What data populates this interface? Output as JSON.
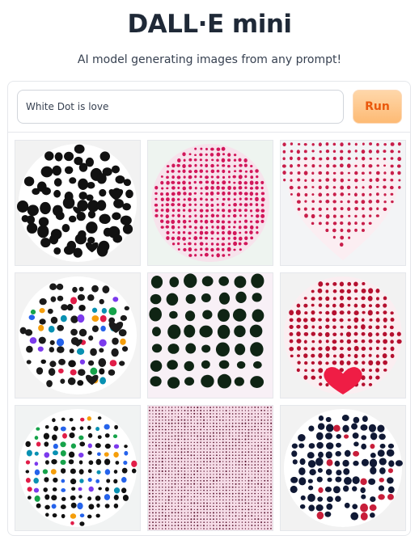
{
  "header": {
    "title": "DALL·E mini",
    "subtitle": "AI model generating images from any prompt!"
  },
  "prompt": {
    "value": "White Dot is love"
  },
  "run_button": {
    "label": "Run"
  },
  "colors": {
    "accent": "#fdba74",
    "accent_text": "#ea580c"
  },
  "gallery": {
    "images": [
      {
        "description_icon": "black-dots-circle",
        "bg": "#f2f2f2",
        "shape": "circle",
        "fill": "#ffffff",
        "dot": "#111111",
        "dotSize": 6,
        "spacing": 15,
        "jitter": 0.7,
        "hearts": true
      },
      {
        "description_icon": "pink-dots-circle",
        "bg": "#eef4f0",
        "shape": "circle",
        "fill": "#f7e3ec",
        "dot": "#d2165a",
        "dotSize": 2,
        "spacing": 7,
        "jitter": 0.15,
        "hearts": false
      },
      {
        "description_icon": "red-dots-heart",
        "bg": "#f3f4f6",
        "shape": "heart",
        "fill": "#fbeef2",
        "dot": "#c81e4a",
        "dotSize": 2,
        "spacing": 9,
        "jitter": 0.1,
        "hearts": false
      },
      {
        "description_icon": "multicolor-dots-circle",
        "bg": "#f3f3f3",
        "shape": "circle",
        "fill": "#ffffff",
        "dot": "#1a1a1a",
        "dotSize": 4,
        "spacing": 13,
        "jitter": 0.5,
        "multicolor": true,
        "hearts": true
      },
      {
        "description_icon": "dark-green-dots-pattern",
        "bg": "#f8f0f6",
        "shape": "square",
        "fill": "#f8f0f6",
        "dot": "#0f2414",
        "dotSize": 7,
        "spacing": 21,
        "jitter": 0.12,
        "hearts": false
      },
      {
        "description_icon": "red-dots-circle-heart",
        "bg": "#f2f2f2",
        "shape": "circle",
        "fill": "#fbeef1",
        "dot": "#b5102f",
        "dotSize": 2.5,
        "spacing": 9,
        "jitter": 0.1,
        "hearts": false,
        "bottomHeart": true
      },
      {
        "description_icon": "rainbow-dots-circle",
        "bg": "#f1f3f3",
        "shape": "circle",
        "fill": "#ffffff",
        "dot": "#111111",
        "dotSize": 3,
        "spacing": 11,
        "jitter": 0.3,
        "multicolor": true,
        "hearts": false
      },
      {
        "description_icon": "pink-grid-pattern",
        "bg": "#f6dde8",
        "shape": "square",
        "fill": "#f6dde8",
        "dot": "#5a1530",
        "dotSize": 0.8,
        "spacing": 4,
        "jitter": 0.05,
        "hearts": false
      },
      {
        "description_icon": "navy-red-dots-circle",
        "bg": "#f2f2f2",
        "shape": "circle",
        "fill": "#ffffff",
        "dot": "#101935",
        "dotSize": 4,
        "spacing": 11,
        "jitter": 0.3,
        "mixed": true,
        "hearts": false
      }
    ]
  }
}
